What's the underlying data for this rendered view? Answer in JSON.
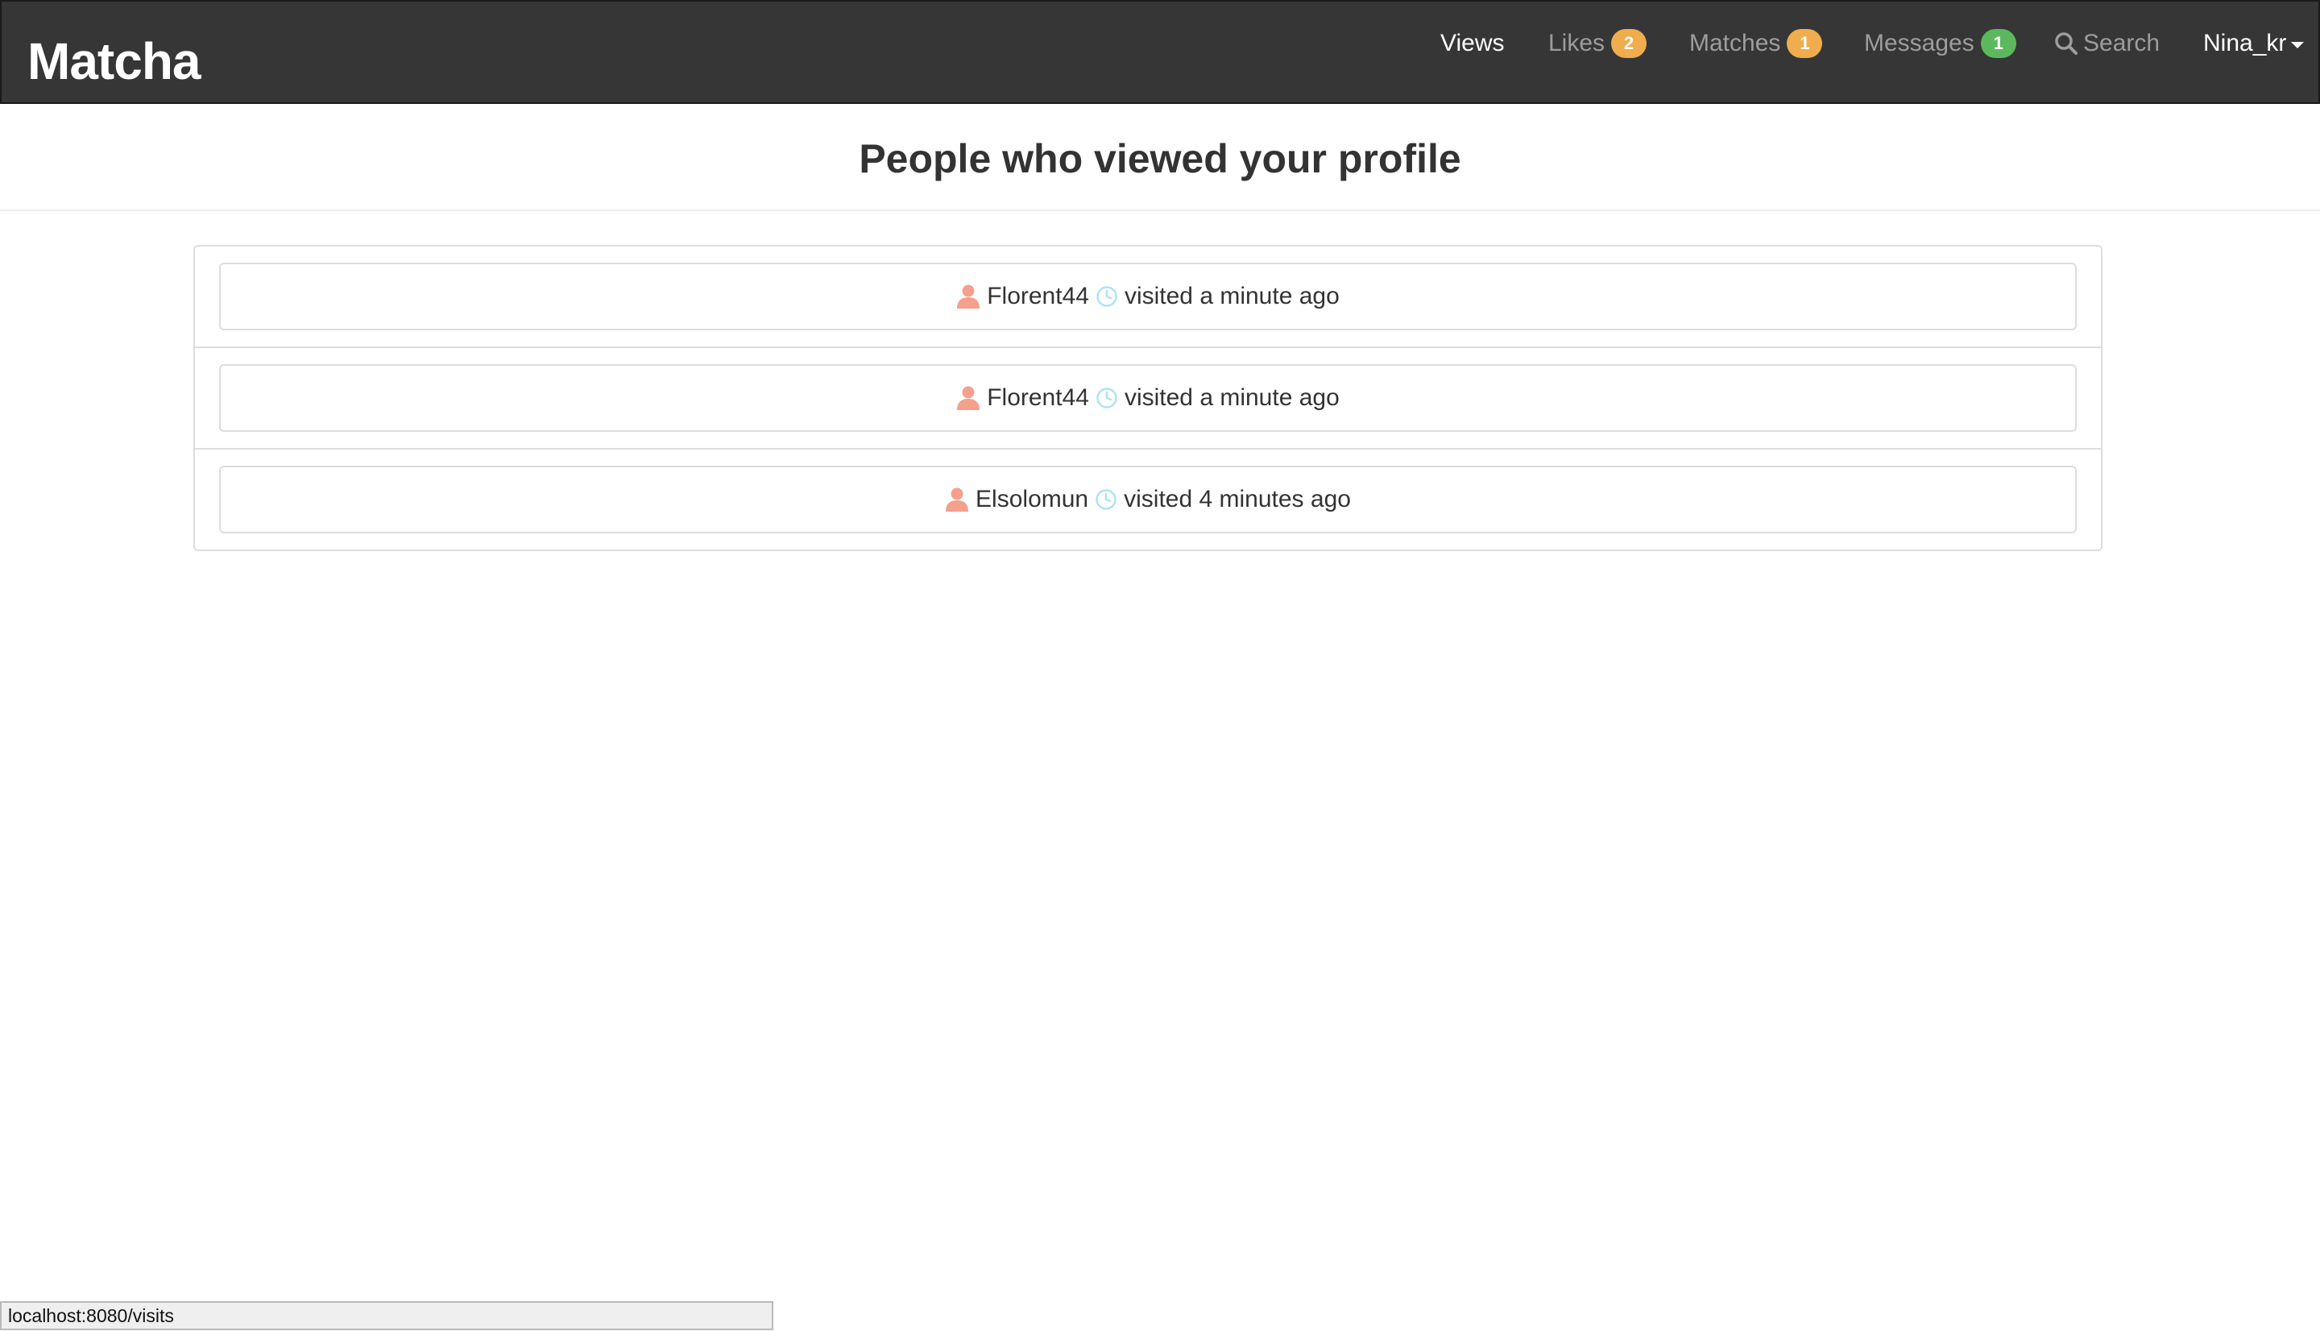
{
  "navbar": {
    "brand": "Matcha",
    "items": [
      {
        "label": "Views"
      },
      {
        "label": "Likes",
        "badge": "2",
        "badge_color": "#f0ad4e"
      },
      {
        "label": "Matches",
        "badge": "1",
        "badge_color": "#f0ad4e"
      },
      {
        "label": "Messages",
        "badge": "1",
        "badge_color": "#5cb85c"
      },
      {
        "label": "Search",
        "icon": "search-icon"
      }
    ],
    "user": "Nina_kr",
    "active_item": "Views"
  },
  "page": {
    "title": "People who viewed your profile"
  },
  "visits": [
    {
      "username": "Florent44",
      "text": "visited a minute ago",
      "user_icon": "user-icon",
      "time_icon": "clock-icon"
    },
    {
      "username": "Florent44",
      "text": "visited a minute ago",
      "user_icon": "user-icon",
      "time_icon": "clock-icon"
    },
    {
      "username": "Elsolomun",
      "text": "visited 4 minutes ago",
      "user_icon": "user-icon",
      "time_icon": "clock-icon"
    }
  ],
  "status_bar": {
    "url": "localhost:8080/visits"
  },
  "colors": {
    "navbar_bg": "#363636",
    "badge_orange": "#f0ad4e",
    "badge_green": "#5cb85c",
    "user_icon": "#f4a08c",
    "clock_icon": "#aee3f5"
  }
}
